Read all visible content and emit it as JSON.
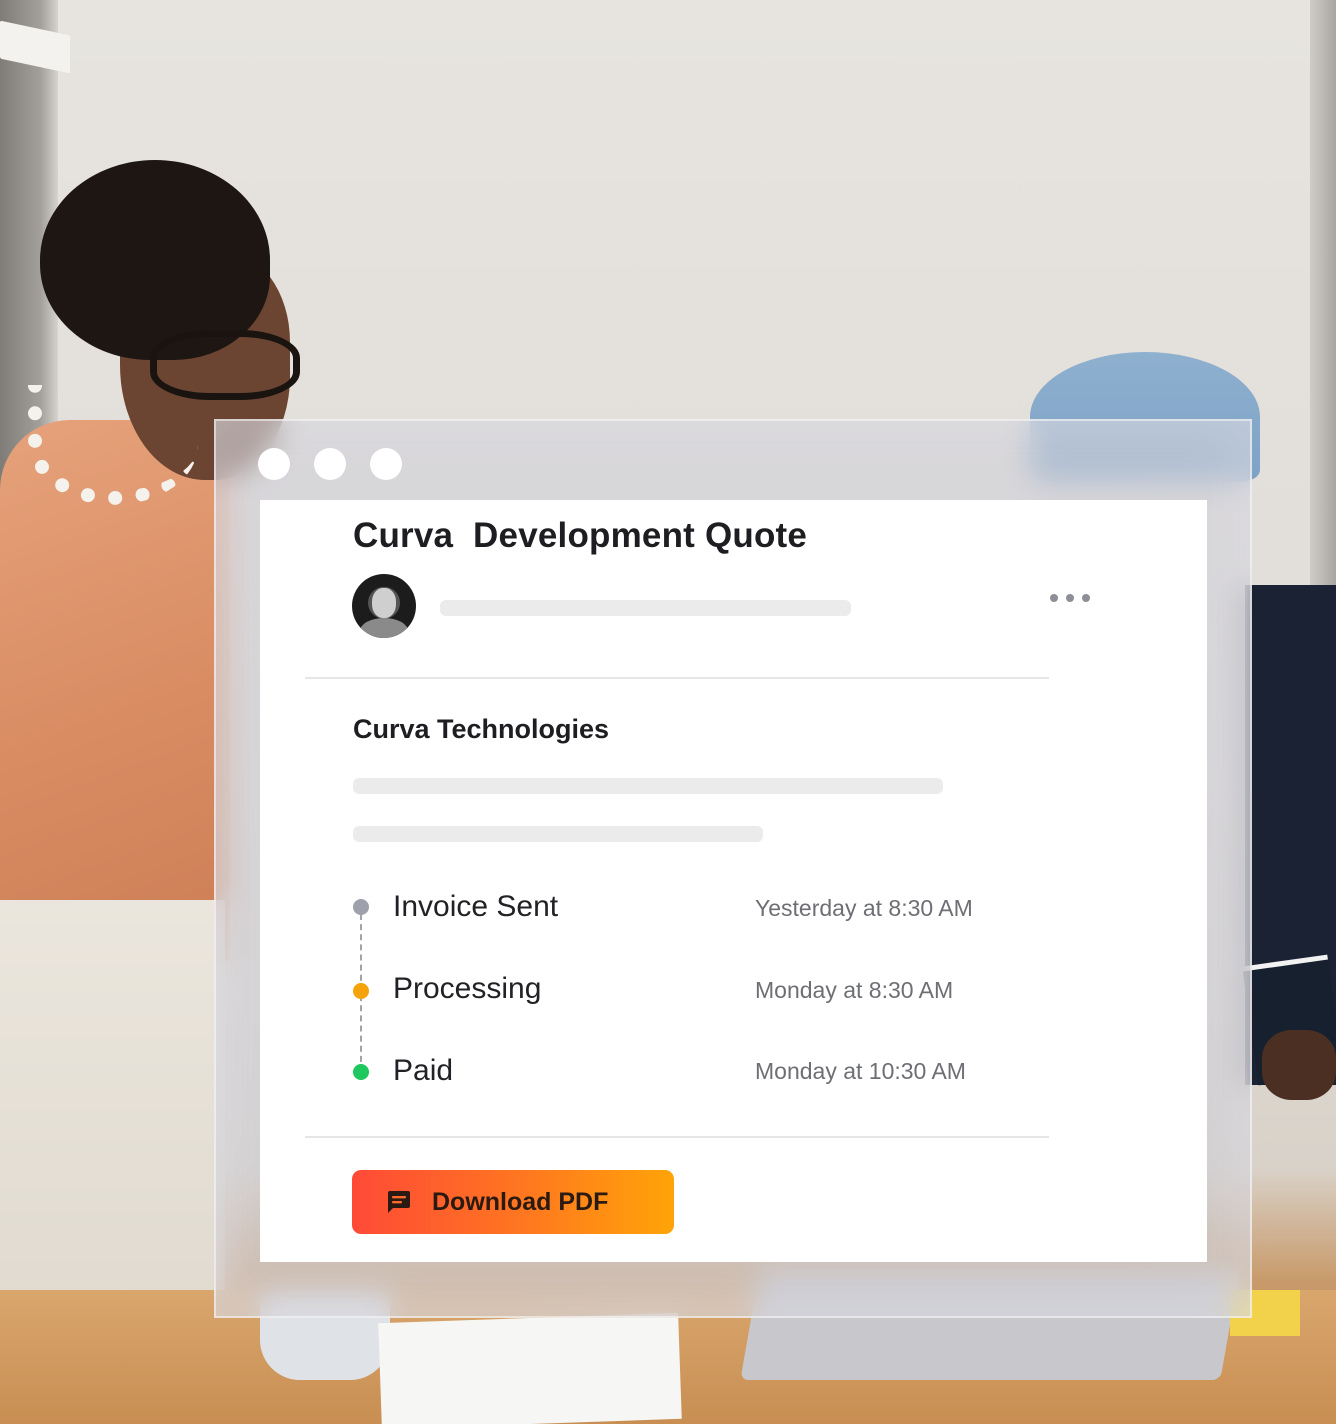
{
  "window": {
    "traffic_lights": [
      "dot",
      "dot",
      "dot"
    ]
  },
  "card": {
    "title": "Curva  Development Quote",
    "more_icon": "more-horizontal-icon",
    "company": "Curva Technologies"
  },
  "timeline": [
    {
      "label": "Invoice Sent",
      "time": "Yesterday at 8:30 AM",
      "color": "#9ea1ab"
    },
    {
      "label": "Processing",
      "time": "Monday at 8:30 AM",
      "color": "#f5a30a"
    },
    {
      "label": "Paid",
      "time": "Monday at 10:30 AM",
      "color": "#1ec85e"
    }
  ],
  "actions": {
    "download_label": "Download PDF",
    "download_icon": "message-square-icon",
    "gradient_start": "#ff4a37",
    "gradient_end": "#ffa408"
  }
}
